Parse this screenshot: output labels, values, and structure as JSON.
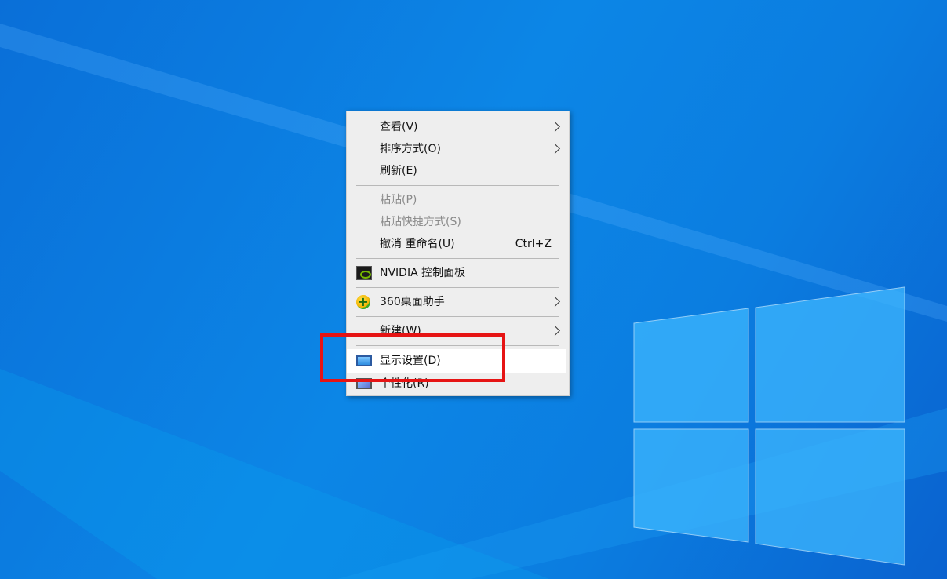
{
  "context_menu": {
    "items": [
      {
        "label": "查看(V)",
        "submenu": true
      },
      {
        "label": "排序方式(O)",
        "submenu": true
      },
      {
        "label": "刷新(E)"
      },
      {
        "label": "粘贴(P)",
        "disabled": true
      },
      {
        "label": "粘贴快捷方式(S)",
        "disabled": true
      },
      {
        "label": "撤消 重命名(U)",
        "shortcut": "Ctrl+Z"
      },
      {
        "label": "NVIDIA 控制面板",
        "icon": "nvidia-icon"
      },
      {
        "label": "360桌面助手",
        "icon": "360-assistant-icon",
        "submenu": true
      },
      {
        "label": "新建(W)",
        "submenu": true
      },
      {
        "label": "显示设置(D)",
        "icon": "monitor-icon",
        "highlighted": true
      },
      {
        "label": "个性化(R)",
        "icon": "personalize-icon"
      }
    ]
  },
  "colors": {
    "desktop_blue": "#0b7de0",
    "menu_background": "#eeeeee",
    "highlight_box": "#e61414"
  }
}
